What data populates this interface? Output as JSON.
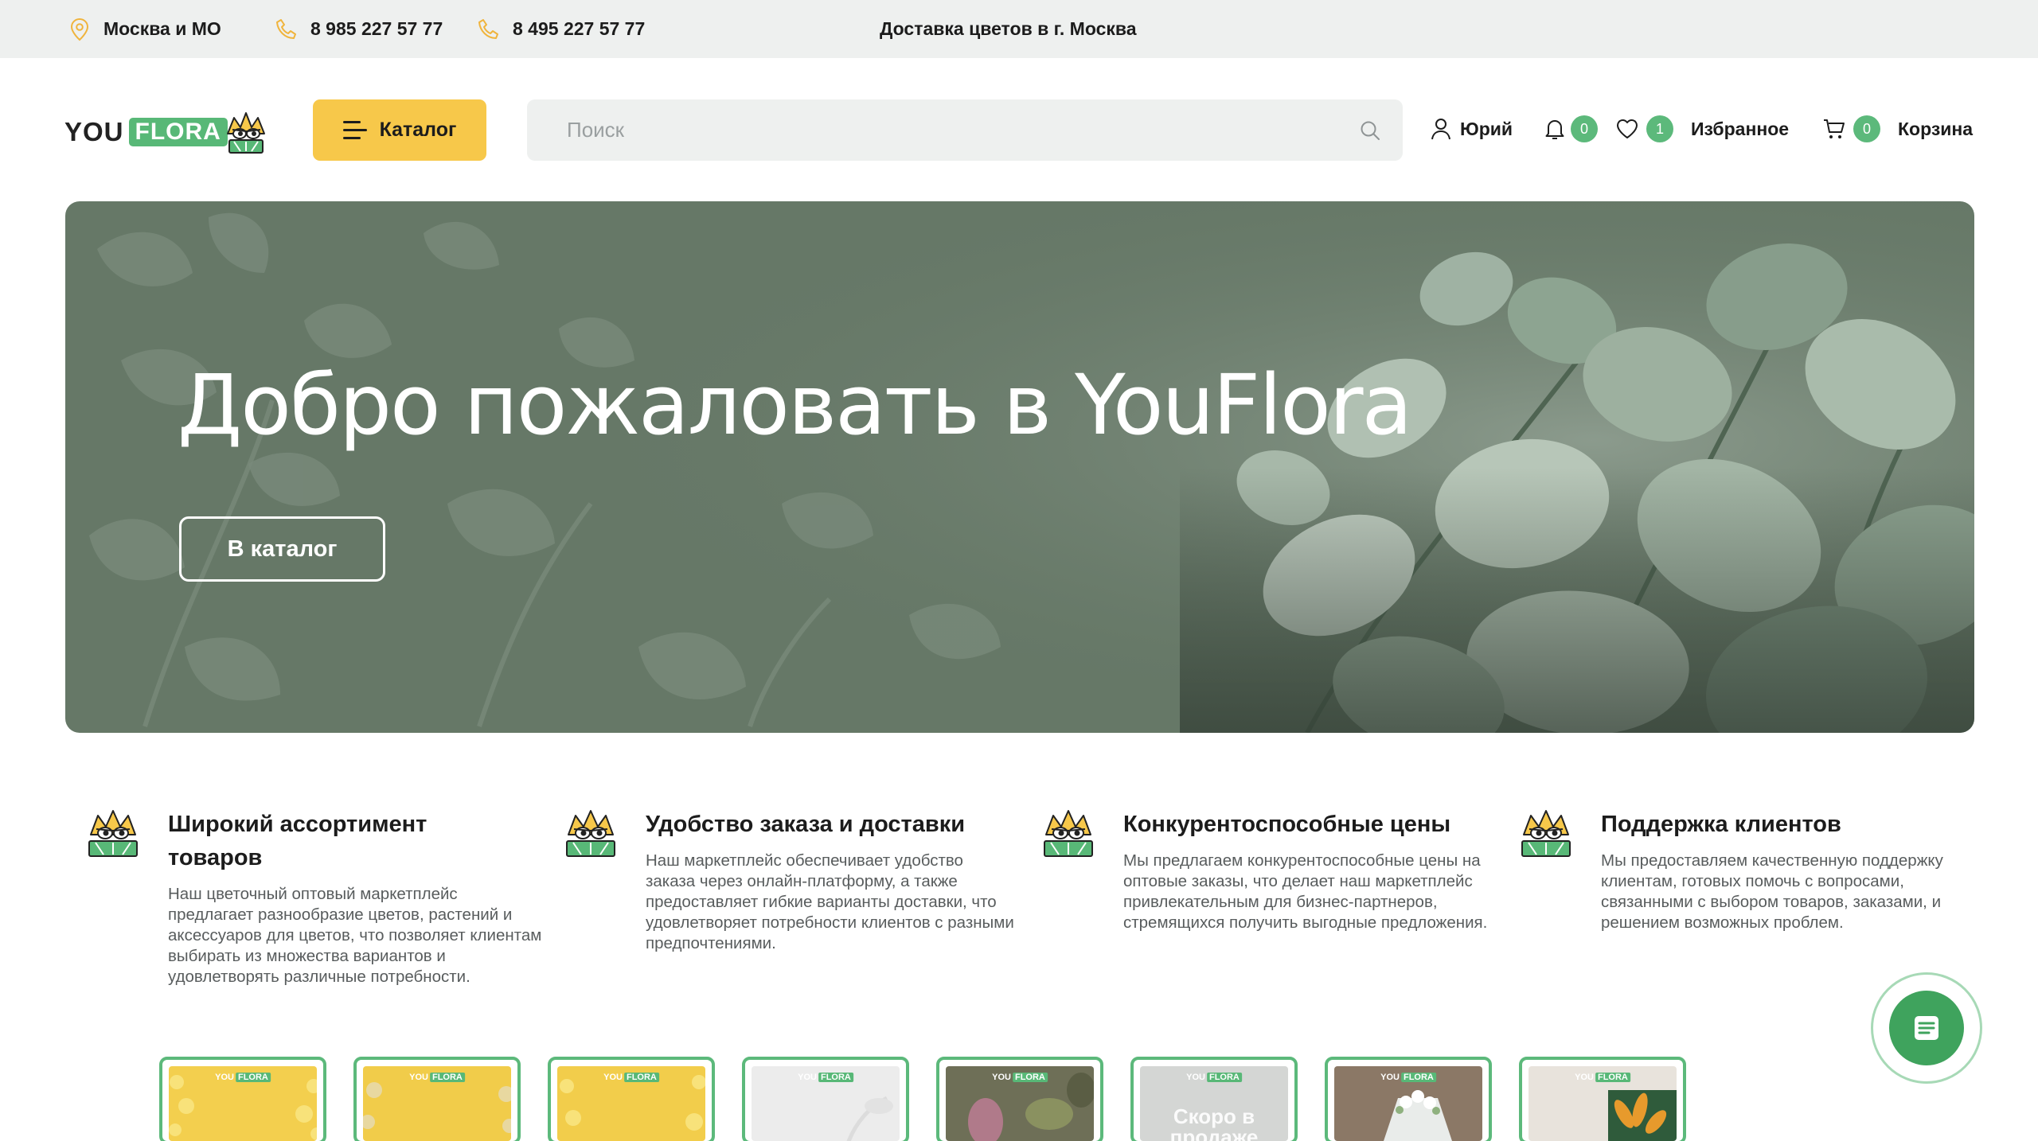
{
  "topbar": {
    "region": "Москва и МО",
    "phone1": "8 985 227 57 77",
    "phone2": "8 495 227 57 77",
    "delivery": "Доставка цветов в г. Москва"
  },
  "header": {
    "logo_you": "YOU",
    "logo_flora": "FLORA",
    "catalog_label": "Каталог",
    "search_placeholder": "Поиск",
    "user_name": "Юрий",
    "notifications_count": "0",
    "favorites_count": "1",
    "favorites_label": "Избранное",
    "cart_count": "0",
    "cart_label": "Корзина"
  },
  "hero": {
    "title": "Добро пожаловать в YouFlora",
    "button_label": "В каталог"
  },
  "features": [
    {
      "title": "Широкий ассортимент товаров",
      "text": "Наш цветочный оптовый маркетплейс предлагает разнообразие цветов, растений и аксессуаров для цветов, что позволяет клиентам выбирать из множества вариантов и удовлетворять различные потребности."
    },
    {
      "title": "Удобство заказа и доставки",
      "text": "Наш маркетплейс обеспечивает удобство заказа через онлайн-платформу, а также предоставляет гибкие варианты доставки, что удовлетворяет потребности клиентов с разными предпочтениями."
    },
    {
      "title": "Конкурентоспособные цены",
      "text": "Мы предлагаем конкурентоспособные цены на оптовые заказы, что делает наш маркетплейс привлекательным для бизнес-партнеров, стремящихся получить выгодные предложения."
    },
    {
      "title": "Поддержка клиентов",
      "text": "Мы предоставляем качественную поддержку клиентам, готовых помочь с вопросами, связанными с выбором товаров, заказами, и решением возможных проблем."
    }
  ],
  "thumbnails": {
    "logo_you": "YOU",
    "logo_flora": "FLORA",
    "soon_label": "Скоро в продаже"
  },
  "colors": {
    "accent_green": "#5cb97b",
    "accent_yellow": "#f7c84a",
    "hero_bg": "#667867",
    "topbar_bg": "#eef0ef"
  },
  "icons": [
    "location-pin-icon",
    "phone-icon",
    "menu-icon",
    "search-icon",
    "user-icon",
    "bell-icon",
    "heart-icon",
    "cart-icon",
    "chat-icon"
  ]
}
